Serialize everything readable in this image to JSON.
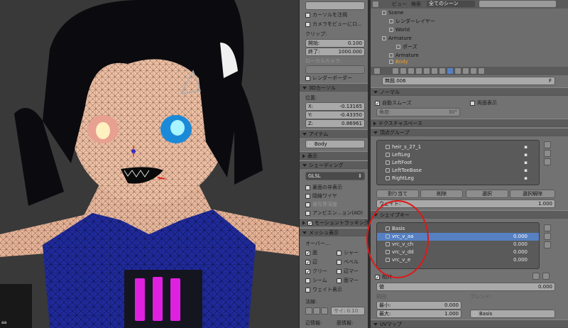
{
  "viewport": {
    "status_text": "aa"
  },
  "props_panel": {
    "top_field": "",
    "lock_camera_label": "カーソルを注視",
    "camera_to_view_label": "カメラをビューにロ...",
    "clip_header": "クリップ:",
    "clip_start_label": "開始:",
    "clip_start_value": "0.100",
    "clip_end_label": "終了:",
    "clip_end_value": "1000.000",
    "local_camera_label": "ローカルカメラ:",
    "render_border_label": "レンダーボーダー",
    "cursor_header": "3Dカーソル",
    "location_label": "位置:",
    "x_label": "X:",
    "x_value": "-0.13165",
    "y_label": "Y:",
    "y_value": "-0.43350",
    "z_label": "Z:",
    "z_value": "0.86961",
    "item_header": "アイテム",
    "item_name": "Body",
    "display_header": "表示",
    "shading_header": "シェーディング",
    "shading_mode": "GLSL",
    "backface_label": "裏面の非表示",
    "hidden_wire_label": "隠線ワイヤ",
    "depth_label": "被写界深度",
    "ao_label": "アンビエン...ョン(AO)",
    "motion_tracking_label": "モーショントラッキング",
    "mesh_display_header": "メッシュ表示",
    "overlay_label": "オーバー...",
    "face_label": "面",
    "sharp_label": "シャー",
    "edge_label": "辺",
    "bevel_label": "ベベル",
    "crease_label": "クリー",
    "edge_mark_label": "辺マー",
    "seam_label": "シーム",
    "face_mark_label": "面マー",
    "weight_label": "ウェイト表示",
    "normals_label": "法線:",
    "size_label": "サイ: 0.10",
    "edge_info_label": "辺情報:",
    "face_info_label": "面情報:"
  },
  "outliner": {
    "menu_view": "ビュー",
    "menu_search": "検索",
    "scene_selector": "全てのシーン",
    "items": [
      "Scene",
      "レンダーレイヤー",
      "World",
      "Armature",
      "ポーズ",
      "Armature",
      "Body"
    ]
  },
  "properties": {
    "mesh_name": "無題.006",
    "mesh_suffix": "F",
    "normals_header": "ノーマル",
    "auto_smooth_label": "自動スムーズ",
    "double_sided_label": "両面表示",
    "angle_label": "角度:",
    "angle_value": "30°",
    "texture_space_header": "テクスチャスペース",
    "vertex_groups_header": "頂点グループ",
    "vertex_groups": [
      "heir_s_27_1",
      "LeftLeg",
      "LeftFoot",
      "LeftToeBase",
      "RightLeg"
    ],
    "assign_label": "割り当て",
    "remove_label": "削除",
    "select_label": "選択",
    "deselect_label": "選択解除",
    "weight_label": "ウェイト:",
    "weight_value": "1.000",
    "shape_keys_header": "シェイプキー",
    "shape_keys": [
      {
        "name": "Basis",
        "value": ""
      },
      {
        "name": "vrc_v_aa",
        "value": "0.000"
      },
      {
        "name": "vrc_v_ch",
        "value": "0.000"
      },
      {
        "name": "vrc_v_dd",
        "value": "0.000"
      },
      {
        "name": "vrc_v_e",
        "value": "0.000"
      }
    ],
    "relative_label": "相対",
    "value_label": "値",
    "value_value": "0.000",
    "range_label": "範囲:",
    "blend_label": "ブレンド:",
    "min_label": "最小:",
    "min_value": "0.000",
    "max_label": "最大:",
    "max_value": "1.000",
    "blend_value": "Basis",
    "uv_maps_header": "UVマップ"
  },
  "colors": {
    "selection": "#5680c2",
    "annotation_circle": "#e01818",
    "panel_bg": "#727272"
  }
}
